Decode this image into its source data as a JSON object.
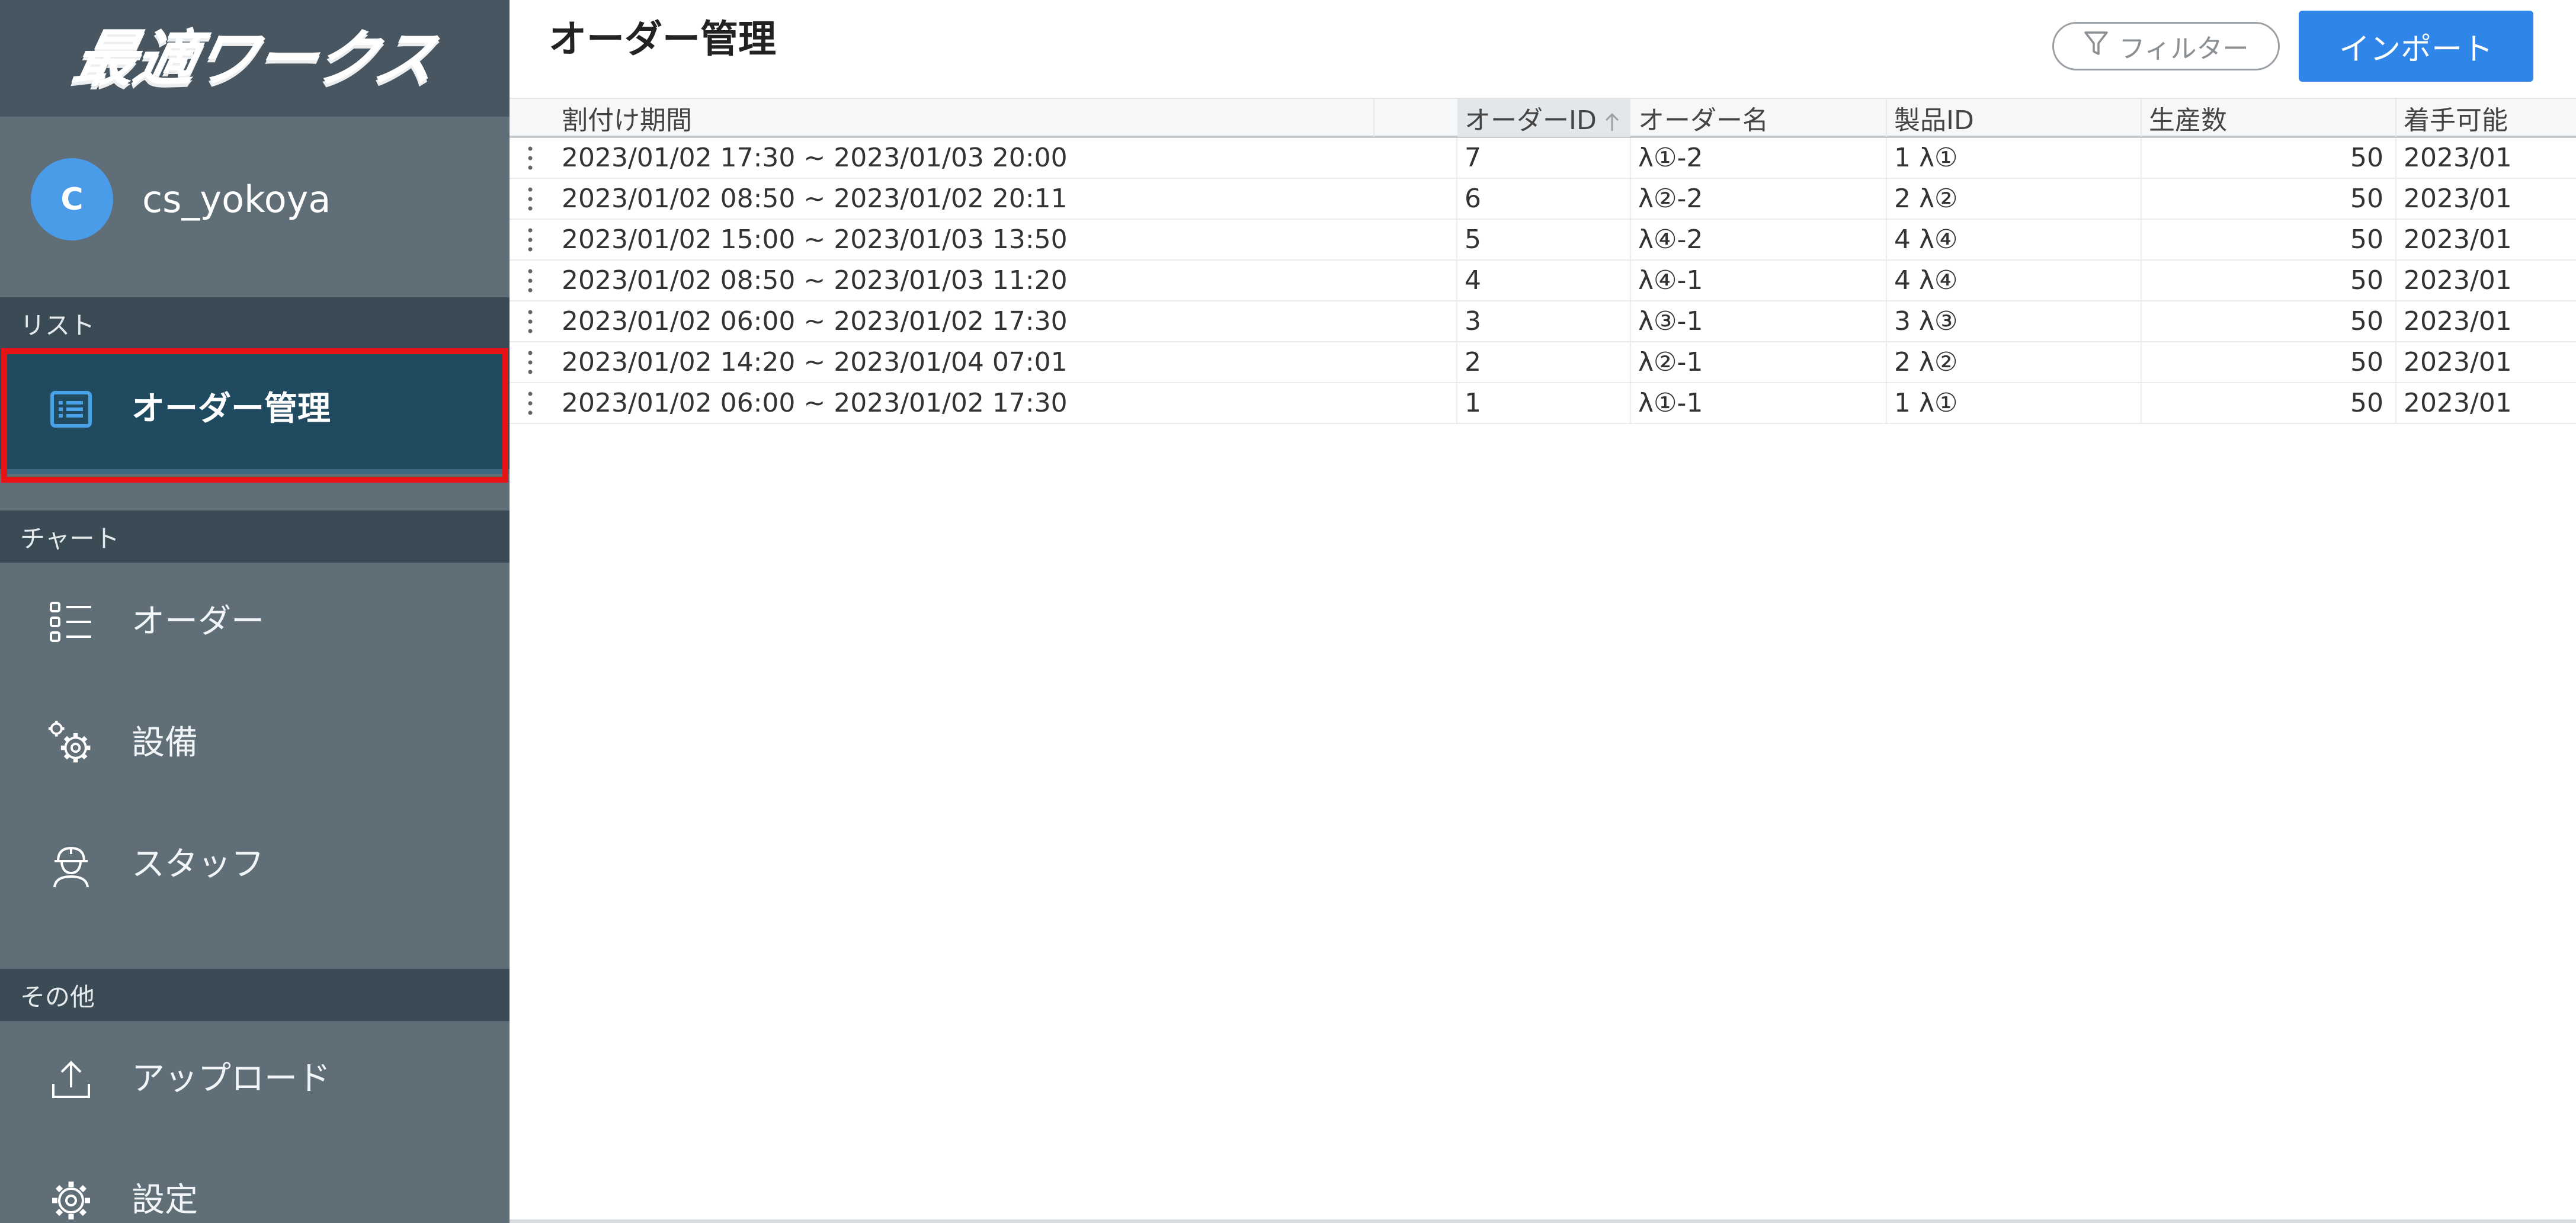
{
  "app": {
    "logo_text": "最適ワークス"
  },
  "user": {
    "avatar_initial": "C",
    "name": "cs_yokoya"
  },
  "sidebar": {
    "sections": {
      "list": "リスト",
      "chart": "チャート",
      "other": "その他"
    },
    "items": [
      {
        "label": "オーダー管理",
        "icon": "list-icon",
        "active": true
      },
      {
        "label": "オーダー",
        "icon": "bullet-list-icon",
        "active": false
      },
      {
        "label": "設備",
        "icon": "gears-icon",
        "active": false
      },
      {
        "label": "スタッフ",
        "icon": "worker-icon",
        "active": false
      },
      {
        "label": "アップロード",
        "icon": "upload-icon",
        "active": false
      },
      {
        "label": "設定",
        "icon": "gear-icon",
        "active": false
      }
    ]
  },
  "header": {
    "title": "オーダー管理",
    "filter_label": "フィルター",
    "import_label": "インポート"
  },
  "table": {
    "columns": [
      "割付け期間",
      "オーダーID",
      "オーダー名",
      "製品ID",
      "生産数",
      "着手可能"
    ],
    "sorted_column": "オーダーID",
    "rows": [
      {
        "period": "2023/01/02 17:30 ~ 2023/01/03 20:00",
        "order_id": "7",
        "order_name": "λ①-2",
        "product_id": "1 λ①",
        "qty": "50",
        "start": "2023/01"
      },
      {
        "period": "2023/01/02 08:50 ~ 2023/01/02 20:11",
        "order_id": "6",
        "order_name": "λ②-2",
        "product_id": "2 λ②",
        "qty": "50",
        "start": "2023/01"
      },
      {
        "period": "2023/01/02 15:00 ~ 2023/01/03 13:50",
        "order_id": "5",
        "order_name": "λ④-2",
        "product_id": "4 λ④",
        "qty": "50",
        "start": "2023/01"
      },
      {
        "period": "2023/01/02 08:50 ~ 2023/01/03 11:20",
        "order_id": "4",
        "order_name": "λ④-1",
        "product_id": "4 λ④",
        "qty": "50",
        "start": "2023/01"
      },
      {
        "period": "2023/01/02 06:00 ~ 2023/01/02 17:30",
        "order_id": "3",
        "order_name": "λ③-1",
        "product_id": "3 λ③",
        "qty": "50",
        "start": "2023/01"
      },
      {
        "period": "2023/01/02 14:20 ~ 2023/01/04 07:01",
        "order_id": "2",
        "order_name": "λ②-1",
        "product_id": "2 λ②",
        "qty": "50",
        "start": "2023/01"
      },
      {
        "period": "2023/01/02 06:00 ~ 2023/01/02 17:30",
        "order_id": "1",
        "order_name": "λ①-1",
        "product_id": "1 λ①",
        "qty": "50",
        "start": "2023/01"
      }
    ]
  },
  "colors": {
    "sidebar_bg": "#5f6e77",
    "sidebar_active": "#1f4a60",
    "accent": "#2f86e8",
    "highlight": "#e61414"
  }
}
